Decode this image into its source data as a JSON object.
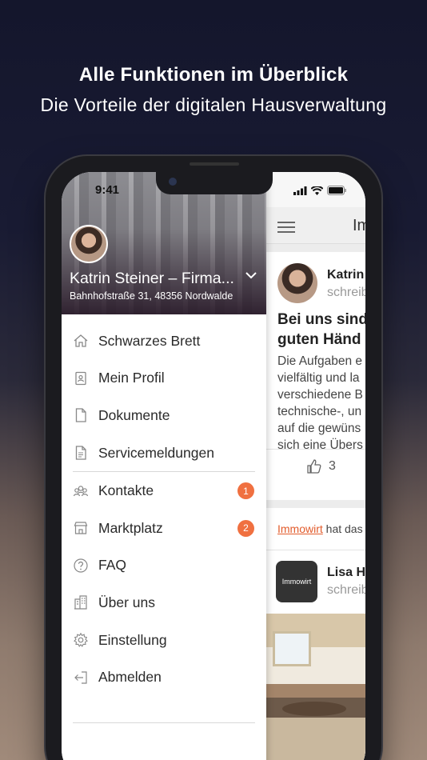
{
  "promo": {
    "headline": "Alle Funktionen im Überblick",
    "subheadline": "Die Vorteile der digitalen Hausverwaltung"
  },
  "status_bar": {
    "time": "9:41"
  },
  "drawer": {
    "user_name": "Katrin Steiner – Firma...",
    "address": "Bahnhofstraße 31, 48356 Nordwalde",
    "menu_items": [
      {
        "label": "Schwarzes Brett",
        "icon": "house-icon"
      },
      {
        "label": "Mein Profil",
        "icon": "profile-card-icon"
      },
      {
        "label": "Dokumente",
        "icon": "document-icon"
      },
      {
        "label": "Servicemeldungen",
        "icon": "report-icon"
      },
      {
        "label": "Kontakte",
        "icon": "contacts-icon",
        "badge": "1"
      },
      {
        "label": "Marktplatz",
        "icon": "store-icon",
        "badge": "2"
      },
      {
        "label": "FAQ",
        "icon": "question-icon"
      },
      {
        "label": "Über uns",
        "icon": "building-icon"
      },
      {
        "label": "Einstellung",
        "icon": "gear-icon"
      },
      {
        "label": "Abmelden",
        "icon": "logout-icon"
      }
    ],
    "badge_color": "#f07040"
  },
  "background_app": {
    "title": "Imm",
    "post": {
      "author": "Katrin",
      "subtitle": "schreib",
      "title_lines": [
        "Bei uns sind",
        "guten Händ"
      ],
      "body_lines": [
        "Die Aufgaben e",
        "vielfältig und la",
        "verschiedene B",
        "technische-, un",
        "auf die gewüns",
        "sich eine Übers"
      ],
      "likes": "3"
    },
    "activity": {
      "link": "Immowirt",
      "text": " hat das"
    },
    "post2": {
      "author": "Lisa H",
      "subtitle": "schreib",
      "logo_text": "Immowirt"
    }
  }
}
